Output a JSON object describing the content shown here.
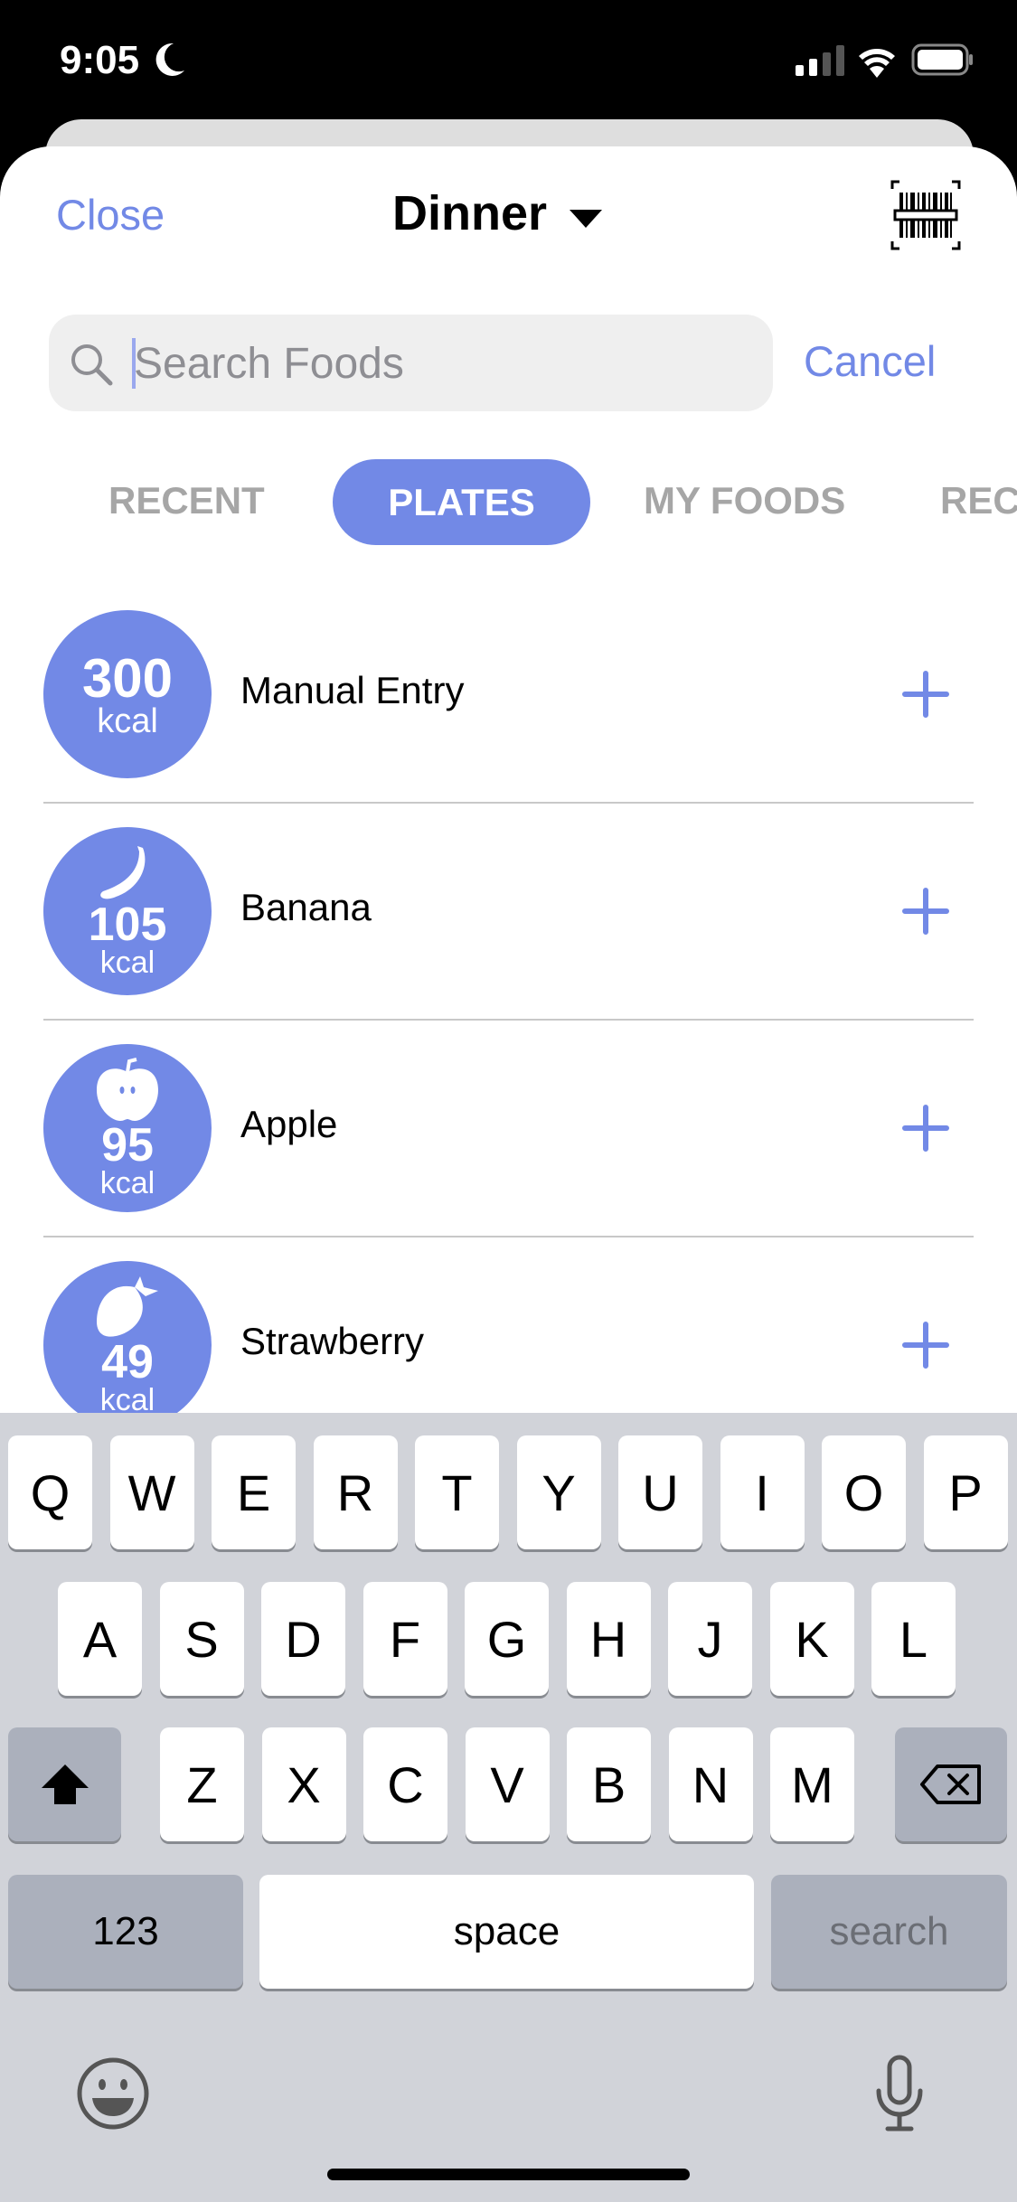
{
  "status_bar": {
    "time": "9:05",
    "icons": [
      "moon-icon",
      "signal-icon",
      "wifi-icon",
      "battery-icon"
    ]
  },
  "header": {
    "close_label": "Close",
    "title": "Dinner",
    "scan_icon": "barcode-icon"
  },
  "search": {
    "placeholder": "Search Foods",
    "value": "",
    "cancel_label": "Cancel"
  },
  "tabs": [
    {
      "label": "RECENT"
    },
    {
      "label": "PLATES",
      "active": true
    },
    {
      "label": "MY FOODS"
    },
    {
      "label": "REC"
    }
  ],
  "items": [
    {
      "name": "Manual Entry",
      "calories": "300",
      "unit": "kcal",
      "icon": ""
    },
    {
      "name": "Banana",
      "calories": "105",
      "unit": "kcal",
      "icon": "banana-icon"
    },
    {
      "name": "Apple",
      "calories": "95",
      "unit": "kcal",
      "icon": "apple-icon"
    },
    {
      "name": "Strawberry",
      "calories": "49",
      "unit": "kcal",
      "icon": "strawberry-icon"
    }
  ],
  "keyboard": {
    "row1": [
      "Q",
      "W",
      "E",
      "R",
      "T",
      "Y",
      "U",
      "I",
      "O",
      "P"
    ],
    "row2": [
      "A",
      "S",
      "D",
      "F",
      "G",
      "H",
      "J",
      "K",
      "L"
    ],
    "row3": [
      "Z",
      "X",
      "C",
      "V",
      "B",
      "N",
      "M"
    ],
    "numbers_label": "123",
    "space_label": "space",
    "search_label": "search"
  },
  "colors": {
    "accent": "#7289e6",
    "keyboard_bg": "#d1d3d9"
  }
}
